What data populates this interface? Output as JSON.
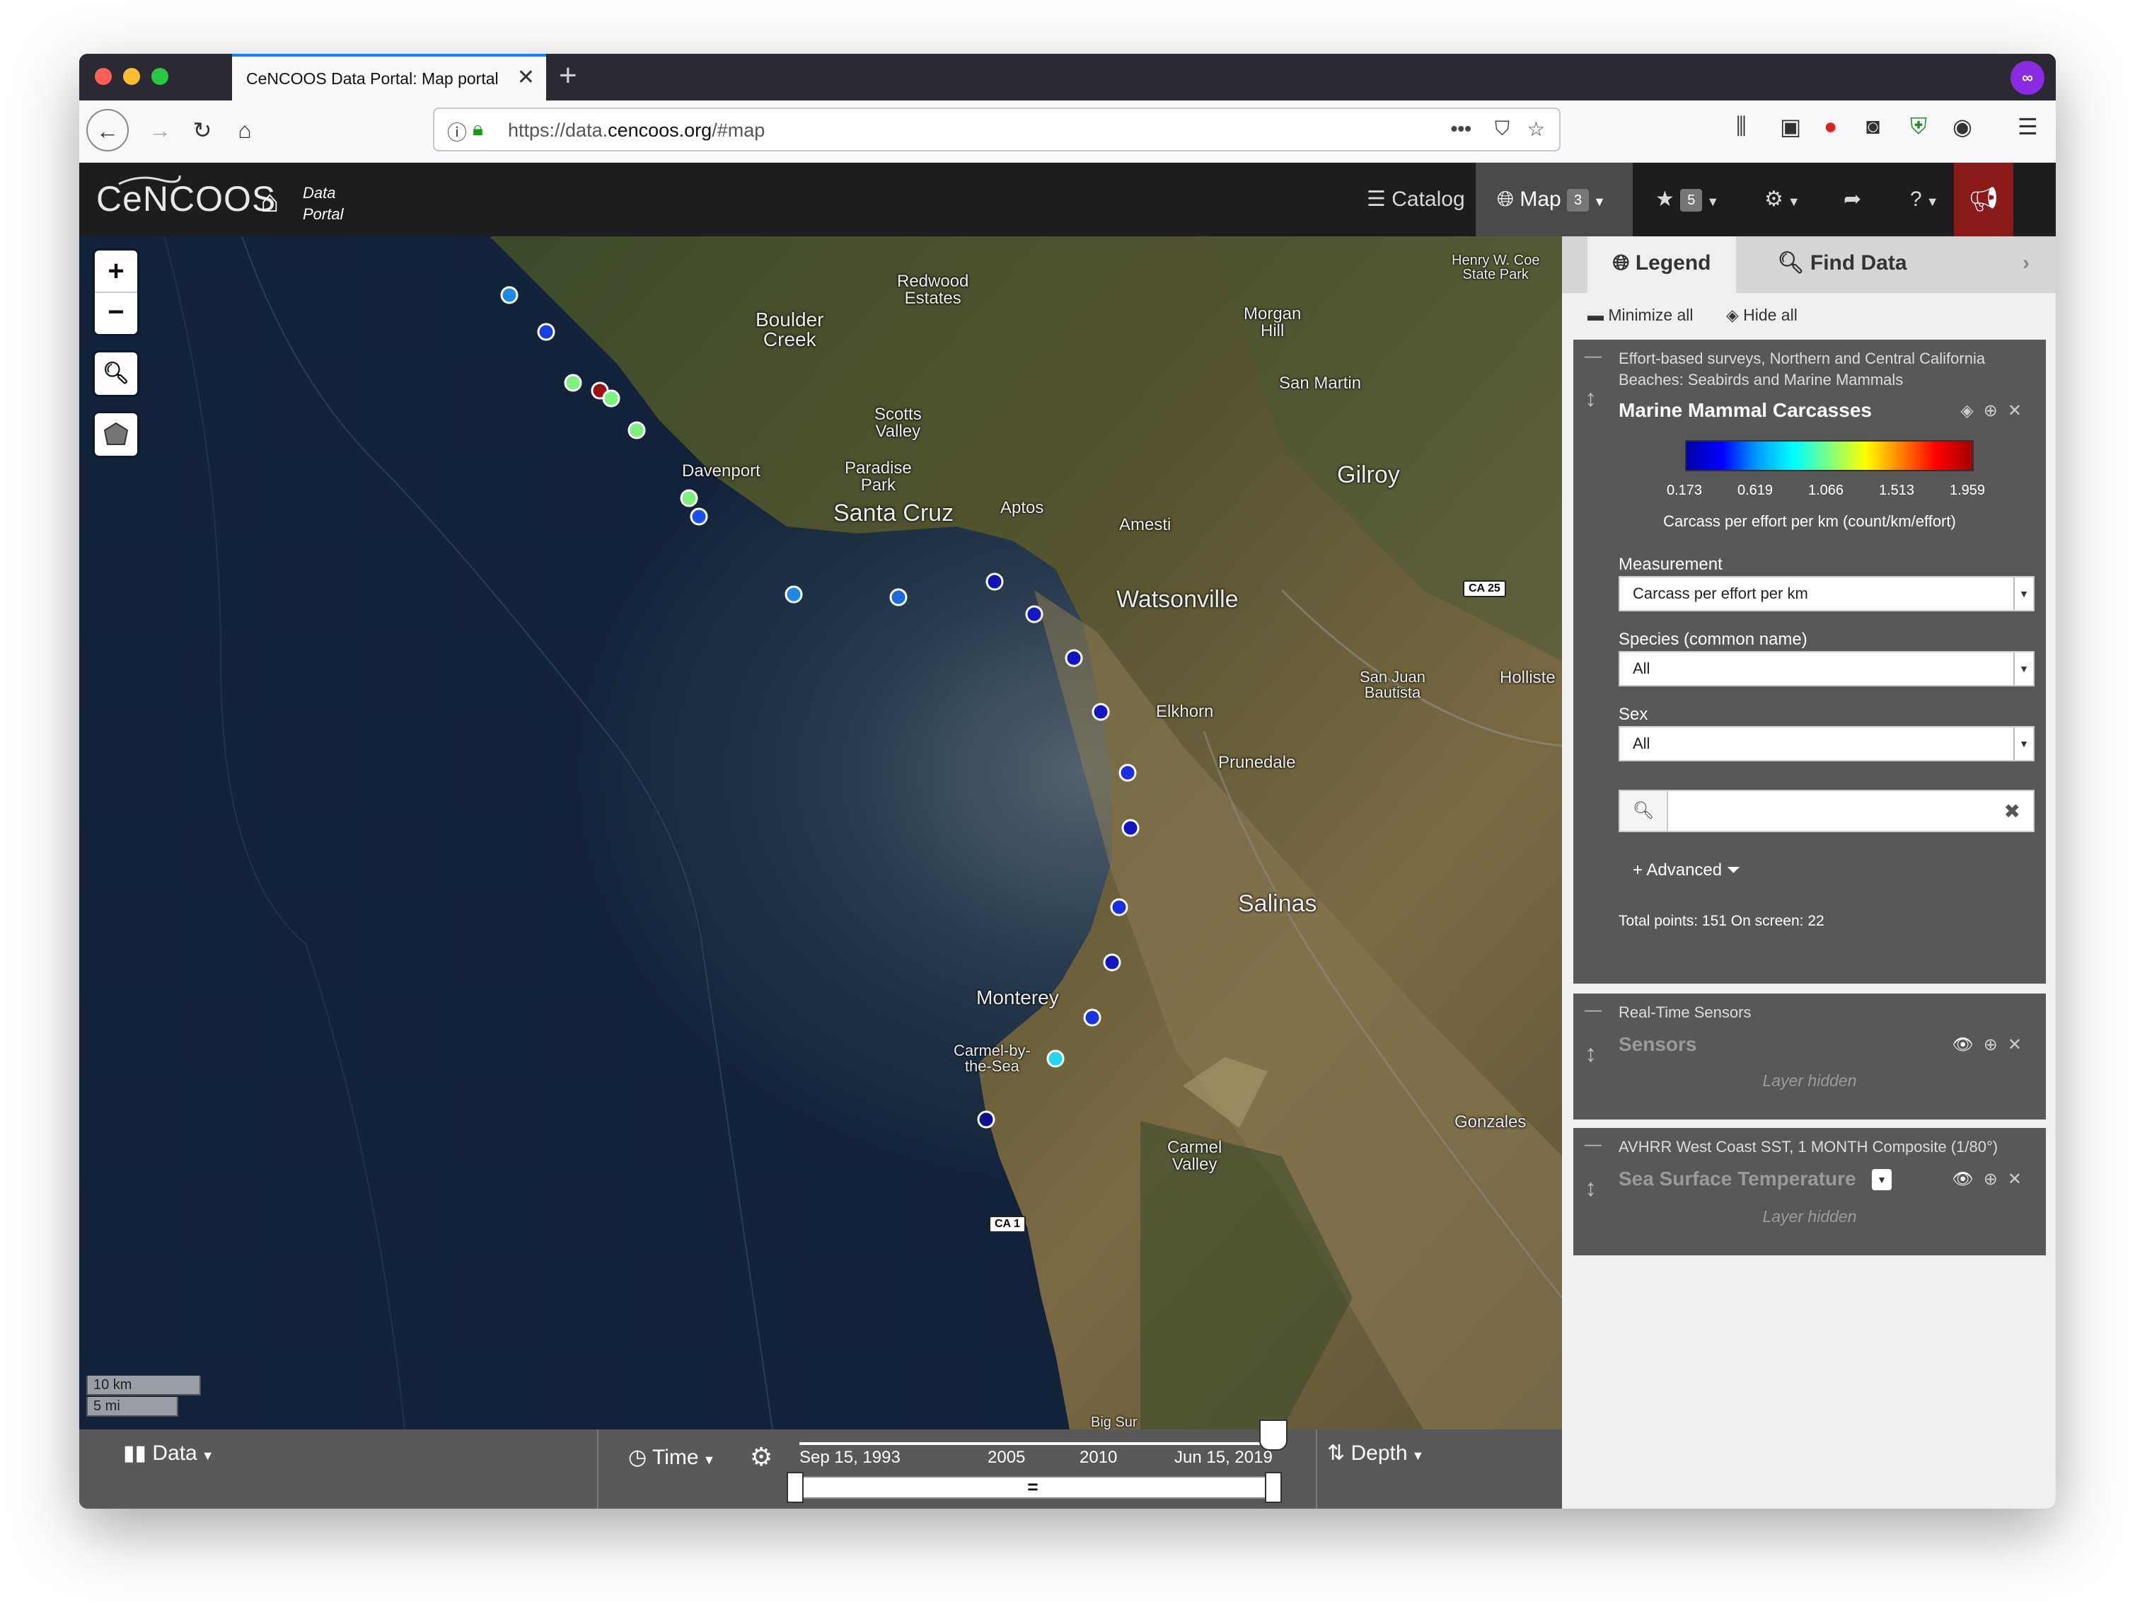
{
  "browser": {
    "tab_title": "CeNCOOS Data Portal: Map portal",
    "tab_close": "✕",
    "new_tab": "+",
    "url_prefix": "https://data.",
    "url_domain": "cencoos.org",
    "url_suffix": "/#map",
    "private_icon": "∞"
  },
  "app": {
    "logo": "CeNCOOS",
    "home_label_line1": "Data",
    "home_label_line2": "Portal",
    "nav": {
      "catalog": "Catalog",
      "map": "Map",
      "map_badge": "3",
      "favorites_badge": "5"
    }
  },
  "map": {
    "zoom_in": "+",
    "zoom_out": "−",
    "places": {
      "redwood_estates": "Redwood\nEstates",
      "boulder_creek": "Boulder\nCreek",
      "morgan_hill": "Morgan\nHill",
      "henry_coe": "Henry W. Coe\nState Park",
      "san_martin": "San Martin",
      "scotts_valley": "Scotts\nValley",
      "paradise_park": "Paradise\nPark",
      "davenport": "Davenport",
      "gilroy": "Gilroy",
      "santa_cruz": "Santa Cruz",
      "aptos": "Aptos",
      "amesti": "Amesti",
      "watsonville": "Watsonville",
      "ca25": "CA 25",
      "san_juan_bautista": "San Juan\nBautista",
      "hollister": "Holliste",
      "elkhorn": "Elkhorn",
      "prunedale": "Prunedale",
      "salinas": "Salinas",
      "monterey": "Monterey",
      "carmel_by_the_sea": "Carmel-by-\nthe-Sea",
      "gonzales": "Gonzales",
      "carmel_valley": "Carmel\nValley",
      "ca1": "CA 1",
      "big_sur": "Big Sur"
    },
    "scale_km": "10 km",
    "scale_mi": "5 mi",
    "points": [
      {
        "value": 0.62,
        "color": "#1e88e5"
      },
      {
        "value": 0.25,
        "color": "#1a3fe0"
      },
      {
        "value": 1.07,
        "color": "#7ef07e"
      },
      {
        "value": 1.96,
        "color": "#9b1010"
      },
      {
        "value": 1.07,
        "color": "#7ef07e"
      },
      {
        "value": 1.07,
        "color": "#7ef07e"
      },
      {
        "value": 1.07,
        "color": "#7ef07e"
      },
      {
        "value": 0.45,
        "color": "#1a52f0"
      },
      {
        "value": 0.62,
        "color": "#1e88e5"
      },
      {
        "value": 0.55,
        "color": "#1b6be0"
      },
      {
        "value": 0.17,
        "color": "#1010b8"
      },
      {
        "value": 0.17,
        "color": "#1416c8"
      },
      {
        "value": 0.17,
        "color": "#1414c0"
      },
      {
        "value": 0.17,
        "color": "#1414c0"
      },
      {
        "value": 0.3,
        "color": "#1a2fe0"
      },
      {
        "value": 0.17,
        "color": "#1414c0"
      },
      {
        "value": 0.3,
        "color": "#1a2fe0"
      },
      {
        "value": 0.17,
        "color": "#1414c0"
      },
      {
        "value": 0.3,
        "color": "#1a32e0"
      },
      {
        "value": 0.8,
        "color": "#22d8f0"
      },
      {
        "value": 0.17,
        "color": "#0e0e90"
      }
    ]
  },
  "bottom": {
    "data_label": "Data",
    "time_label": "Time",
    "depth_label": "Depth",
    "start_date": "Sep 15, 1993",
    "end_date": "Jun 15, 2019",
    "tick_2005": "2005",
    "tick_2010": "2010",
    "slider_mid": "="
  },
  "panel": {
    "tab_legend": "Legend",
    "tab_find": "Find Data",
    "minimize_all": "Minimize all",
    "hide_all": "Hide all",
    "layer1": {
      "subtitle": "Effort-based surveys, Northern and Central California Beaches: Seabirds and Marine Mammals",
      "title": "Marine Mammal Carcasses",
      "colorbar_ticks": [
        "0.173",
        "0.619",
        "1.066",
        "1.513",
        "1.959"
      ],
      "colorbar_label": "Carcass per effort per km (count/km/effort)",
      "measurement_label": "Measurement",
      "measurement_value": "Carcass per effort per km",
      "species_label": "Species (common name)",
      "species_value": "All",
      "sex_label": "Sex",
      "sex_value": "All",
      "advanced": "Advanced",
      "totals": "Total points: 151 On screen: 22"
    },
    "layer2": {
      "subtitle": "Real-Time Sensors",
      "title": "Sensors",
      "hidden": "Layer hidden"
    },
    "layer3": {
      "subtitle": "AVHRR West Coast SST, 1 MONTH Composite (1/80°)",
      "title": "Sea Surface Temperature",
      "hidden": "Layer hidden"
    }
  },
  "colors": {
    "app_bar": "#1d1d1f",
    "alert": "#8b1a1a",
    "panel_layer": "#585858",
    "ocean": "#0f1a2a"
  }
}
